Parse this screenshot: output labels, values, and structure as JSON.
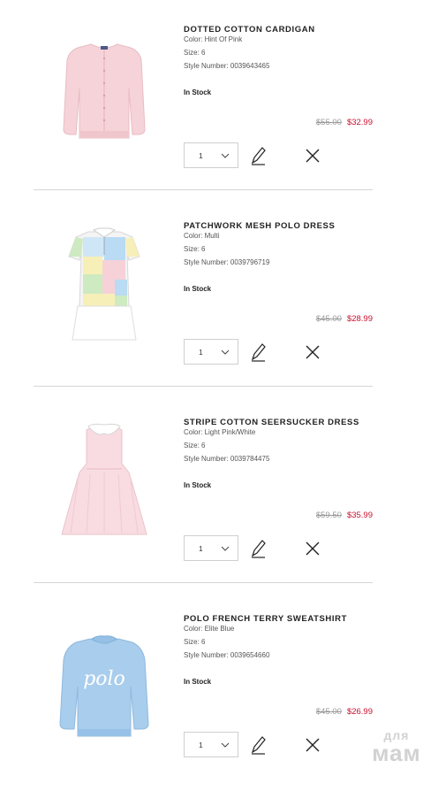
{
  "items": [
    {
      "name": "DOTTED COTTON CARDIGAN",
      "color": "Color: Hint Of Pink",
      "size": "Size: 6",
      "style": "Style Number: 0039643465",
      "stock": "In Stock",
      "old_price": "$55.00",
      "new_price": "$32.99",
      "qty": "1",
      "thumb_icon": "pink-cardigan"
    },
    {
      "name": "PATCHWORK MESH POLO DRESS",
      "color": "Color: Multi",
      "size": "Size: 6",
      "style": "Style Number: 0039796719",
      "stock": "In Stock",
      "old_price": "$45.00",
      "new_price": "$28.99",
      "qty": "1",
      "thumb_icon": "patchwork-polo-dress"
    },
    {
      "name": "STRIPE COTTON SEERSUCKER DRESS",
      "color": "Color: Light Pink/White",
      "size": "Size: 6",
      "style": "Style Number: 0039784475",
      "stock": "In Stock",
      "old_price": "$59.50",
      "new_price": "$35.99",
      "qty": "1",
      "thumb_icon": "pink-seersucker-dress"
    },
    {
      "name": "POLO FRENCH TERRY SWEATSHIRT",
      "color": "Color: Elite Blue",
      "size": "Size: 6",
      "style": "Style Number: 0039654660",
      "stock": "In Stock",
      "old_price": "$45.00",
      "new_price": "$26.99",
      "qty": "1",
      "thumb_icon": "blue-sweatshirt",
      "print": "polo"
    }
  ],
  "watermark": {
    "line1": "для",
    "line2": "мам"
  },
  "colors": {
    "sale_price": "#c8102e",
    "old_price": "#9a9a9a",
    "divider": "#d6d6d6",
    "cardigan": "#f6d3d8",
    "sweatshirt": "#a9cdec"
  }
}
